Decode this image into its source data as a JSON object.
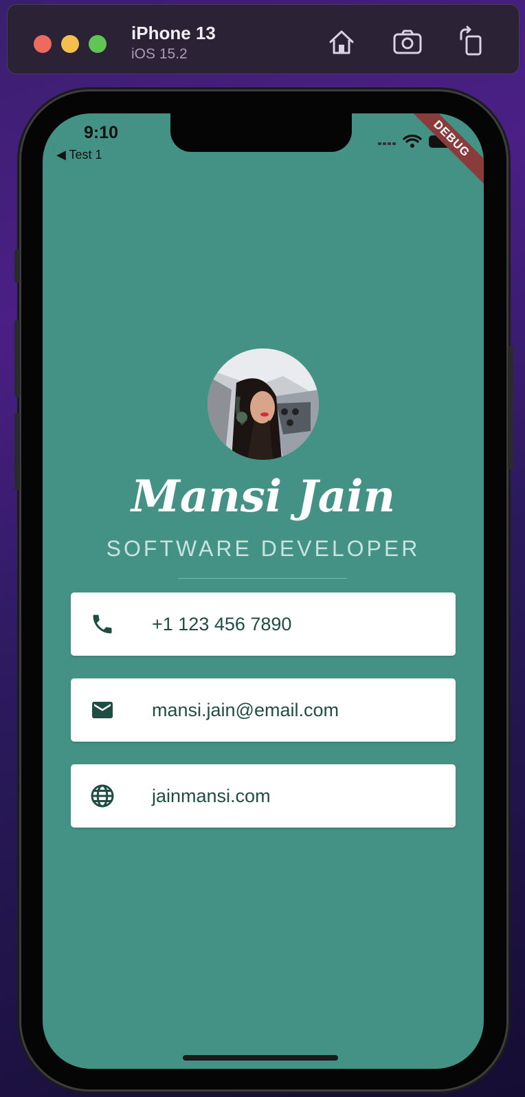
{
  "simulator": {
    "device_name": "iPhone 13",
    "os_version": "iOS 15.2",
    "home_icon": "home-icon",
    "screenshot_icon": "camera-icon",
    "rotate_icon": "rotate-icon"
  },
  "status_bar": {
    "time": "9:10",
    "back_label": "◀ Test 1",
    "debug_banner": "DEBUG"
  },
  "profile": {
    "name": "Mansi Jain",
    "title": "SOFTWARE DEVELOPER"
  },
  "contacts": [
    {
      "icon": "phone-icon",
      "value": "+1 123 456 7890"
    },
    {
      "icon": "mail-icon",
      "value": "mansi.jain@email.com"
    },
    {
      "icon": "globe-icon",
      "value": "jainmansi.com"
    }
  ],
  "colors": {
    "background": "#449286",
    "card": "#ffffff",
    "icon": "#1f4d44",
    "subtitle": "#c7e4df"
  }
}
